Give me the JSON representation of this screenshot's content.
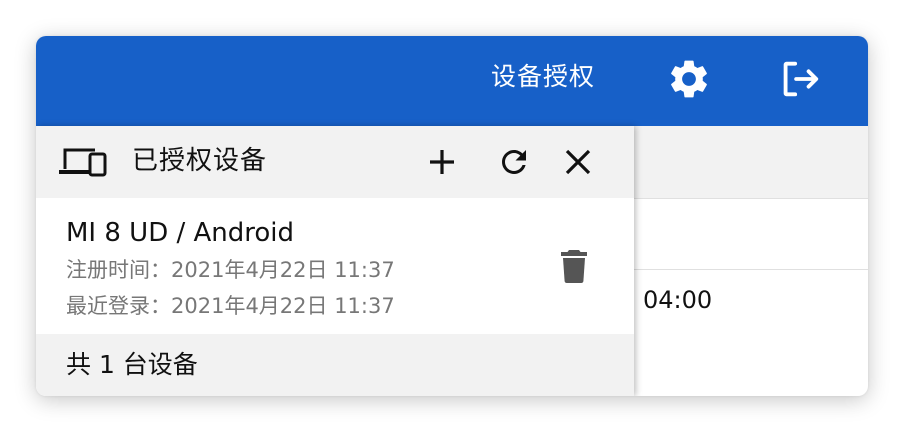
{
  "header": {
    "title": "设备授权",
    "settings_icon": "gear-icon",
    "logout_icon": "logout-icon",
    "background_color": "#1760c8"
  },
  "background": {
    "time_text": "04:00"
  },
  "panel": {
    "title": "已授权设备",
    "title_icon": "devices-icon",
    "actions": [
      "add-icon",
      "refresh-icon",
      "close-icon"
    ],
    "devices": [
      {
        "name": "MI 8 UD / Android",
        "registered": "注册时间：2021年4月22日 11:37",
        "last_login": "最近登录：2021年4月22日 11:37",
        "delete_icon": "trash-icon"
      }
    ],
    "footer": "共 1 台设备"
  }
}
